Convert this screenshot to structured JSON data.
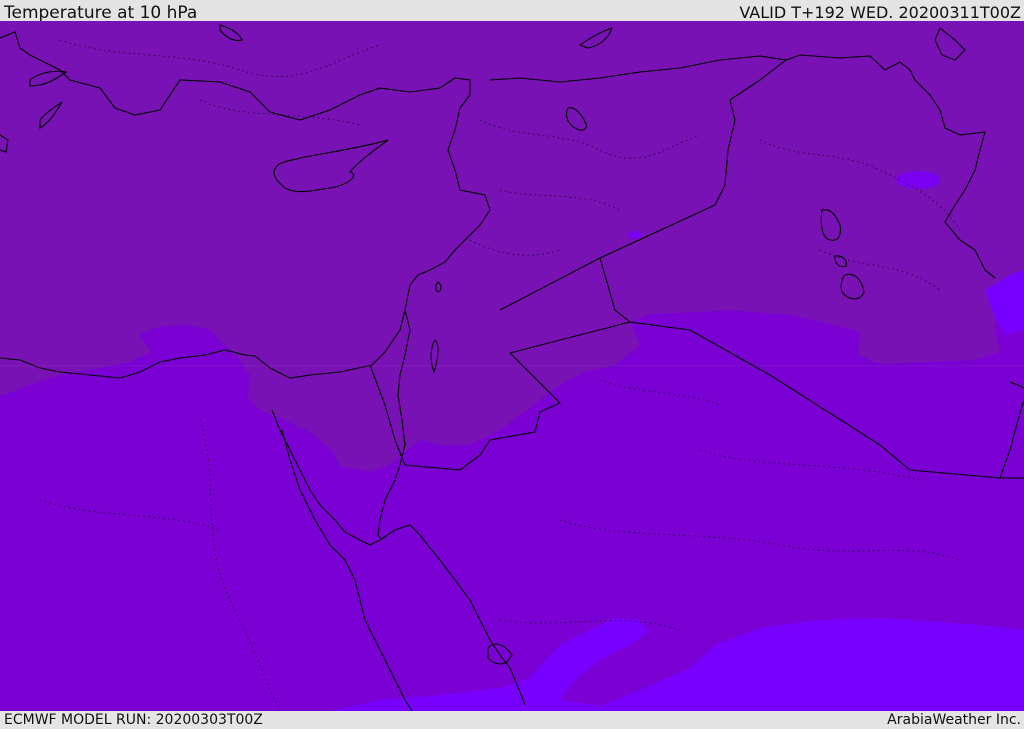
{
  "header": {
    "title": "Temperature at 10 hPa",
    "valid_time": "VALID T+192 WED. 20200311T00Z"
  },
  "footer": {
    "model_run": "ECMWF MODEL RUN: 20200303T00Z",
    "credit": "ArabiaWeather Inc."
  },
  "map": {
    "field": "temperature",
    "level": "10 hPa",
    "colors": {
      "warm_band": "#7912b4",
      "mid_band": "#7a00d4",
      "cold_band": "#7700ff",
      "coastline": "#000000"
    }
  }
}
